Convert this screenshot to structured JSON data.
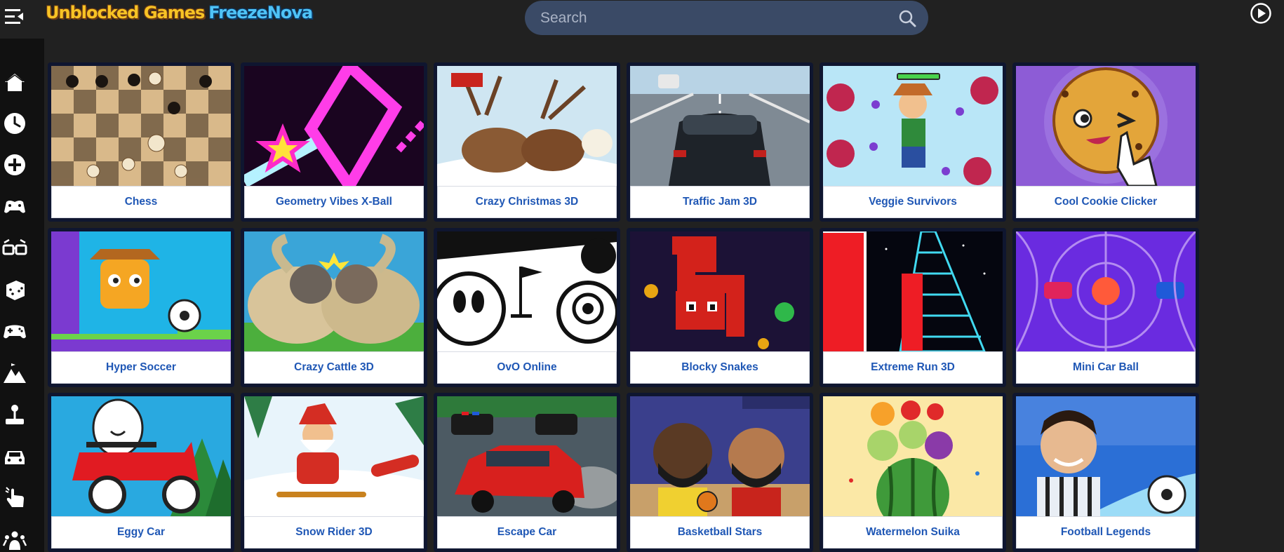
{
  "header": {
    "logo_part1": "Unblocked Games",
    "logo_part2": "FreezeNova",
    "search_placeholder": "Search",
    "icons": [
      "menu-icon",
      "search-icon",
      "play-circle-icon"
    ]
  },
  "sidebar": {
    "items": [
      {
        "icon": "home-icon"
      },
      {
        "icon": "clock-icon"
      },
      {
        "icon": "plus-circle-icon"
      },
      {
        "icon": "gamepad-icon"
      },
      {
        "icon": "3d-glasses-icon"
      },
      {
        "icon": "dice-icon"
      },
      {
        "icon": "controller-icon"
      },
      {
        "icon": "mountain-icon"
      },
      {
        "icon": "joystick-icon"
      },
      {
        "icon": "car-icon"
      },
      {
        "icon": "tap-hand-icon"
      },
      {
        "icon": "crowd-icon"
      }
    ]
  },
  "games": [
    {
      "title": "Chess",
      "colors": [
        "#d9b98a",
        "#3b2a1c"
      ]
    },
    {
      "title": "Geometry Vibes X-Ball",
      "colors": [
        "#1a0520",
        "#ff3de8"
      ]
    },
    {
      "title": "Crazy Christmas 3D",
      "colors": [
        "#cfe6f2",
        "#8a5a34"
      ]
    },
    {
      "title": "Traffic Jam 3D",
      "colors": [
        "#7f8a94",
        "#1e2329"
      ]
    },
    {
      "title": "Veggie Survivors",
      "colors": [
        "#b9e6f7",
        "#c0264f"
      ]
    },
    {
      "title": "Cool Cookie Clicker",
      "colors": [
        "#8d5cd6",
        "#e3a53a"
      ]
    },
    {
      "title": "Hyper Soccer",
      "colors": [
        "#1fb4e6",
        "#f5a623"
      ]
    },
    {
      "title": "Crazy Cattle 3D",
      "colors": [
        "#3aa5d8",
        "#d8c49a"
      ]
    },
    {
      "title": "OvO Online",
      "colors": [
        "#ffffff",
        "#111111"
      ]
    },
    {
      "title": "Blocky Snakes",
      "colors": [
        "#1c1236",
        "#d3221b"
      ]
    },
    {
      "title": "Extreme Run 3D",
      "colors": [
        "#05060f",
        "#ee1d25"
      ]
    },
    {
      "title": "Mini Car Ball",
      "colors": [
        "#6a2be0",
        "#ff5a3a"
      ]
    },
    {
      "title": "Eggy Car",
      "colors": [
        "#29a9e0",
        "#e11b22"
      ]
    },
    {
      "title": "Snow Rider 3D",
      "colors": [
        "#e8f4fb",
        "#d42d23"
      ]
    },
    {
      "title": "Escape Car",
      "colors": [
        "#4c5a63",
        "#d8201e"
      ]
    },
    {
      "title": "Basketball Stars",
      "colors": [
        "#3a3f8c",
        "#5a3a24"
      ]
    },
    {
      "title": "Watermelon Suika",
      "colors": [
        "#fbe8a6",
        "#3f9a3a"
      ]
    },
    {
      "title": "Football Legends",
      "colors": [
        "#2b6fd6",
        "#e9eef5"
      ]
    }
  ]
}
